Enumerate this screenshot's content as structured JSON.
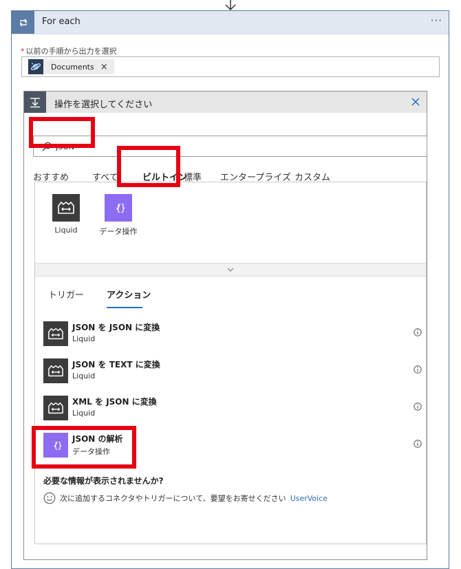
{
  "colors": {
    "accent": "#1a6fc9",
    "foreach_bar": "#5b7ca6",
    "highlight_red": "#e60012",
    "liquid_icon_bg": "#3c3c3c",
    "data_op_icon_bg": "#8c6cf0",
    "link": "#2f6db8"
  },
  "foreach": {
    "title": "For each",
    "icon": "loop-icon",
    "more": "···",
    "previous_output_label": "以前の手順から出力を選択",
    "required_mark": "*",
    "token": {
      "label": "Documents",
      "icon": "cosmos-db-icon",
      "close": "×"
    }
  },
  "action_picker": {
    "title": "操作を選択してください",
    "header_icon": "action-icon",
    "close_icon": "close-icon",
    "search": {
      "value": "JSON",
      "icon": "search-icon"
    },
    "tabs": [
      {
        "label": "おすすめ",
        "active": false
      },
      {
        "label": "すべて",
        "active": false
      },
      {
        "label": "ビルトイン",
        "active": true
      },
      {
        "label": "標準",
        "active": false
      },
      {
        "label": "エンタープライズ",
        "active": false
      },
      {
        "label": "カスタム",
        "active": false
      }
    ],
    "connectors": [
      {
        "label": "Liquid",
        "icon": "liquid-icon"
      },
      {
        "label": "データ操作",
        "icon": "data-operation-icon"
      }
    ],
    "collapse_icon": "chevron-down-icon",
    "subtabs": [
      {
        "label": "トリガー",
        "active": false
      },
      {
        "label": "アクション",
        "active": true
      }
    ],
    "actions": [
      {
        "title": "JSON を JSON に変換",
        "connector": "Liquid",
        "icon": "liquid-icon"
      },
      {
        "title": "JSON を TEXT に変換",
        "connector": "Liquid",
        "icon": "liquid-icon"
      },
      {
        "title": "XML を JSON に変換",
        "connector": "Liquid",
        "icon": "liquid-icon"
      },
      {
        "title": "JSON の解析",
        "connector": "データ操作",
        "icon": "data-operation-icon"
      }
    ],
    "info_icon": "info-icon",
    "missing_title": "必要な情報が表示されませんか?",
    "suggestion_text": "次に追加するコネクタやトリガーについて、要望をお寄せください",
    "suggestion_link": "UserVoice",
    "suggestion_icon": "smile-icon"
  }
}
